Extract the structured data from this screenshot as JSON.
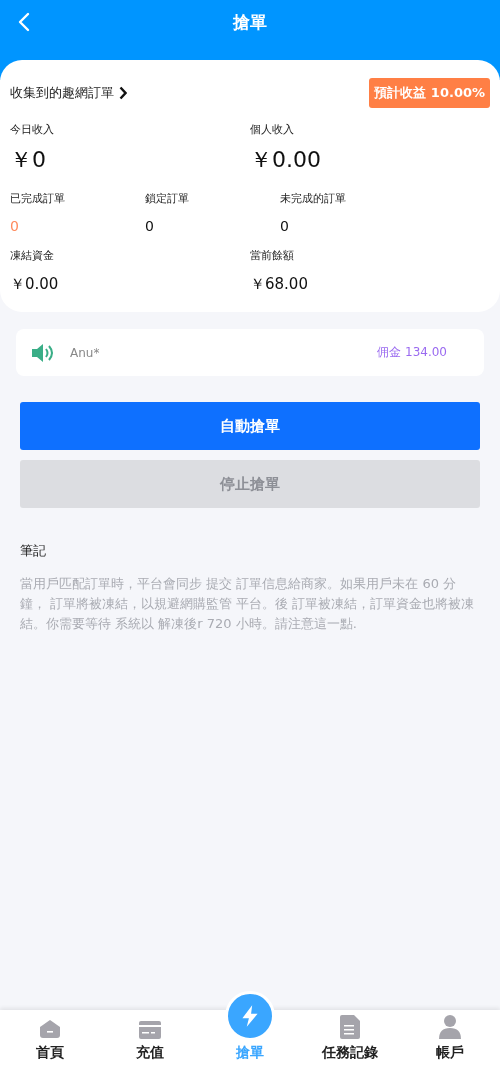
{
  "header": {
    "title": "搶單"
  },
  "summary": {
    "link": "收集到的趣網訂單",
    "badge": "預計收益 10.00%",
    "income": [
      {
        "label": "今日收入",
        "value": "￥0"
      },
      {
        "label": "個人收入",
        "value": "￥0.00"
      }
    ],
    "orders": [
      {
        "label": "已完成訂單",
        "value": "0",
        "highlight": true
      },
      {
        "label": "鎖定訂單",
        "value": "0",
        "highlight": false
      },
      {
        "label": "未完成的訂單",
        "value": "0",
        "highlight": false
      }
    ],
    "funds": [
      {
        "label": "凍結資金",
        "value": "￥0.00"
      },
      {
        "label": "當前餘額",
        "value": "￥68.00"
      }
    ]
  },
  "ticker": {
    "user": "Anu*",
    "commission": "佣金 134.00"
  },
  "buttons": [
    {
      "label": "自動搶單",
      "disabled": false
    },
    {
      "label": "停止搶單",
      "disabled": true
    }
  ],
  "notes": {
    "title": "筆記",
    "text": "當用戶匹配訂單時，平台會同步 提交 訂單信息給商家。如果用戶未在 60  分鐘， 訂單將被凍結，以規避網購監管 平台。後 訂單被凍結，訂單資金也將被凍結。你需要等待 系統以 解凍後r 720 小時。請注意這一點."
  },
  "nav": [
    {
      "label": "首頁",
      "selected": false
    },
    {
      "label": "充值",
      "selected": false
    },
    {
      "label": "搶單",
      "selected": true
    },
    {
      "label": "任務記錄",
      "selected": false
    },
    {
      "label": "帳戶",
      "selected": false
    }
  ]
}
